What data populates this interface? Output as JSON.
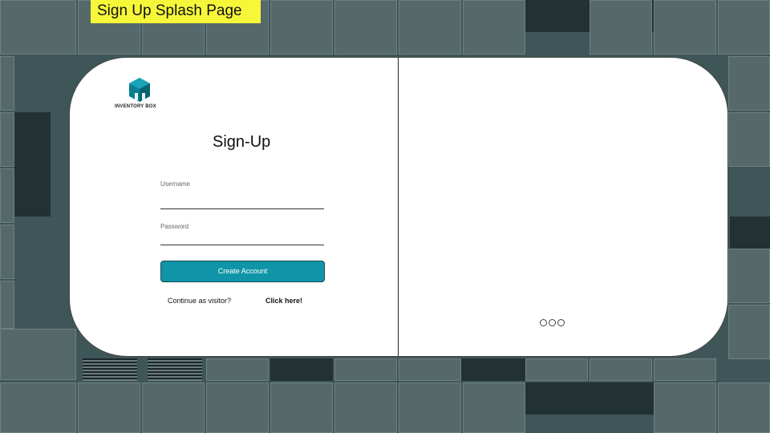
{
  "banner": {
    "label": "Sign Up Splash Page"
  },
  "logo": {
    "text": "INVENTORY BOX",
    "icon": "cube-icon",
    "color": "#0b7f93"
  },
  "form": {
    "title": "Sign-Up",
    "username_label": "Username",
    "username_value": "",
    "password_label": "Password",
    "password_value": "",
    "submit_label": "Create Account"
  },
  "visitor": {
    "prompt": "Continue as visitor?",
    "link_label": "Click here!"
  },
  "carousel": {
    "slide_count": 3
  },
  "colors": {
    "accent": "#0f95a7",
    "banner": "#f7f73a"
  }
}
